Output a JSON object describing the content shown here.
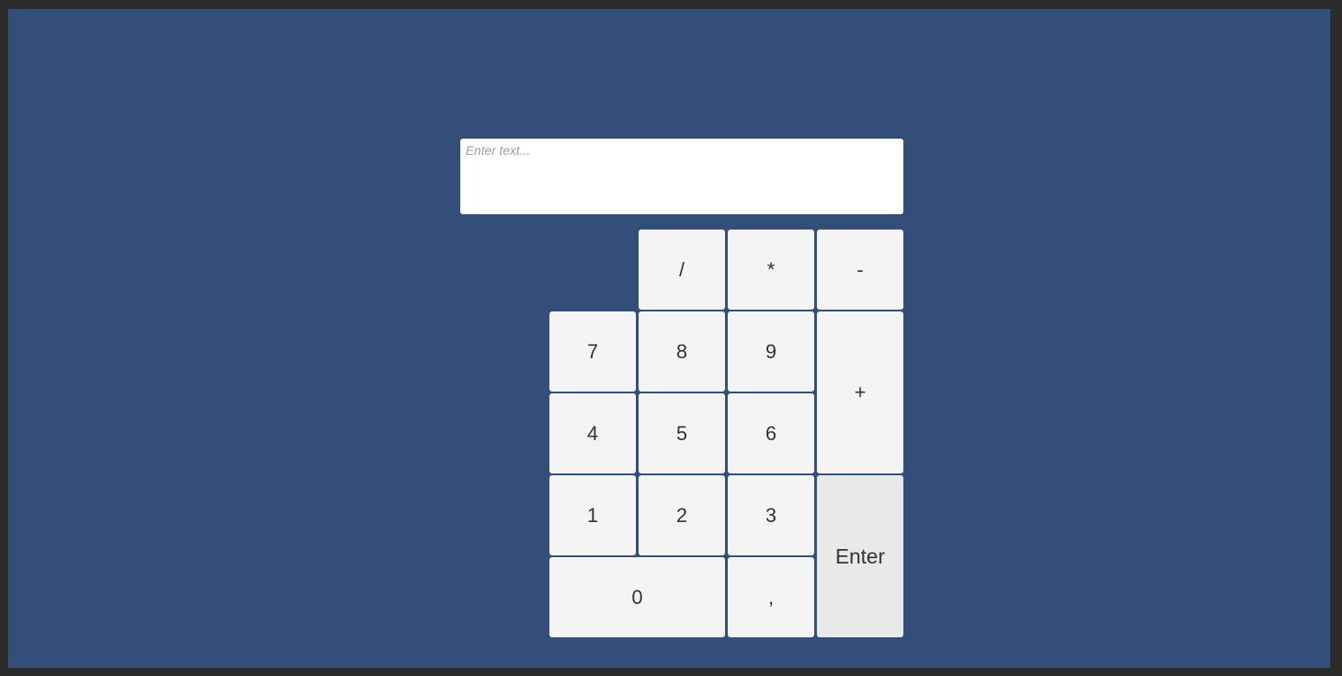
{
  "input": {
    "value": "",
    "placeholder": "Enter text..."
  },
  "keypad": {
    "divide": "/",
    "multiply": "*",
    "minus": "-",
    "seven": "7",
    "eight": "8",
    "nine": "9",
    "plus": "+",
    "four": "4",
    "five": "5",
    "six": "6",
    "one": "1",
    "two": "2",
    "three": "3",
    "enter": "Enter",
    "zero": "0",
    "comma": ","
  },
  "colors": {
    "background": "#324e79",
    "frame": "#2b2b2b",
    "key": "#f4f4f4",
    "enter_key": "#e9e9e9",
    "text": "#323232"
  }
}
